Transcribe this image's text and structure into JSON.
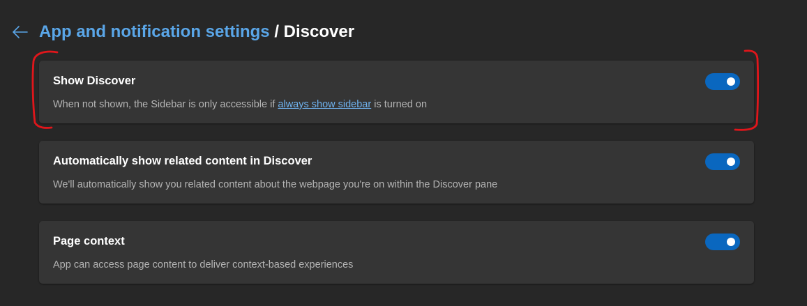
{
  "header": {
    "breadcrumb_parent": "App and notification settings",
    "breadcrumb_separator": " / ",
    "breadcrumb_current": "Discover",
    "back_icon": "arrow-left-icon"
  },
  "settings": [
    {
      "title": "Show Discover",
      "desc_before": "When not shown, the Sidebar is only accessible if ",
      "desc_link": "always show sidebar",
      "desc_after": " is turned on",
      "enabled": true
    },
    {
      "title": "Automatically show related content in Discover",
      "desc_before": "We'll automatically show you related content about the webpage you're on within the Discover pane",
      "enabled": true
    },
    {
      "title": "Page context",
      "desc_before": "App can access page content to deliver context-based experiences",
      "enabled": true
    }
  ],
  "colors": {
    "background": "#272727",
    "card": "#353535",
    "accent": "#0a67bf",
    "link": "#5aa6e8",
    "annotation": "#e0161b"
  }
}
